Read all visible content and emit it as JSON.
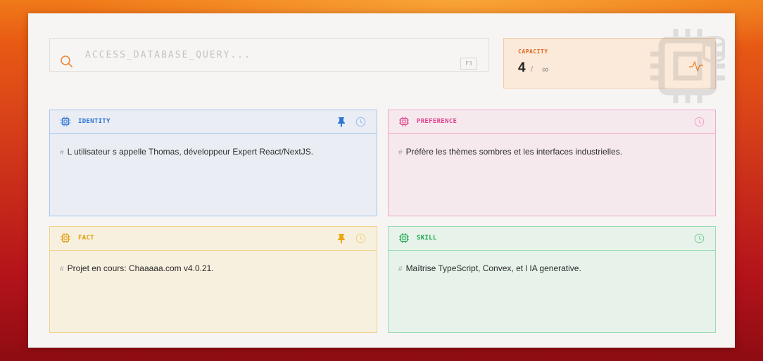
{
  "search": {
    "placeholder": "ACCESS_DATABASE_QUERY...",
    "shortcut": "F3",
    "icon": "search-icon"
  },
  "capacity": {
    "label": "CAPACITY",
    "value": "4",
    "separator": "/",
    "max": "∞",
    "icon": "activity-icon"
  },
  "colors": {
    "identity": "#2d74d6",
    "preference": "#e0428b",
    "fact": "#e09a0a",
    "skill": "#16a34a",
    "capacity": "#e0661c"
  },
  "cards": [
    {
      "title": "IDENTITY",
      "hash": "#",
      "text": "L utilisateur s appelle Thomas, développeur Expert React/NextJS.",
      "pinned": true
    },
    {
      "title": "PREFERENCE",
      "hash": "#",
      "text": "Préfère les thèmes sombres et les interfaces industrielles.",
      "pinned": false
    },
    {
      "title": "FACT",
      "hash": "#",
      "text": "Projet en cours: Chaaaaa.com v4.0.21.",
      "pinned": true
    },
    {
      "title": "SKILL",
      "hash": "#",
      "text": "Maîtrise TypeScript, Convex, et l IA generative.",
      "pinned": false
    }
  ]
}
